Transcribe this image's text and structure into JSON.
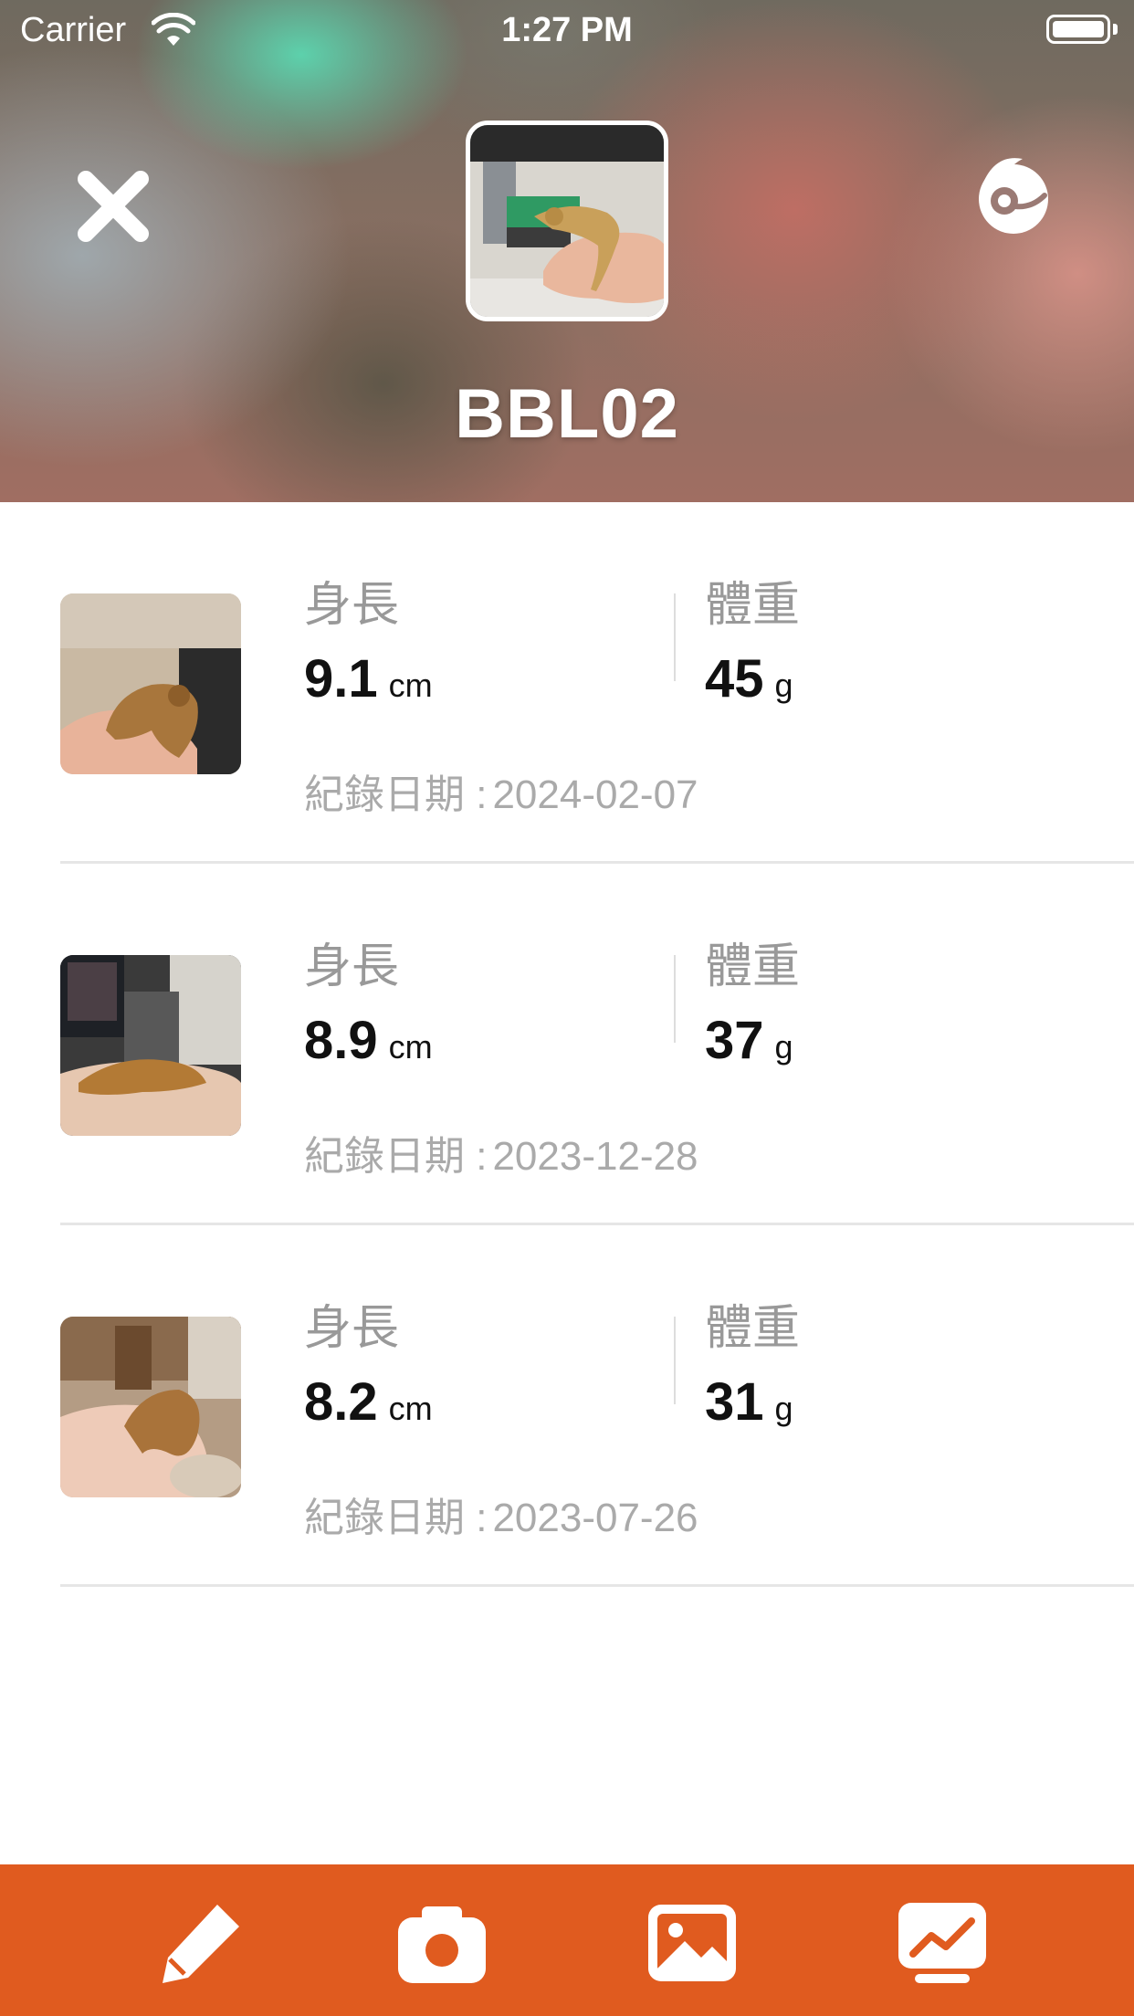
{
  "status_bar": {
    "carrier": "Carrier",
    "time": "1:27 PM"
  },
  "header": {
    "title": "BBL02",
    "close_icon": "close-icon",
    "switch_icon": "chameleon-icon"
  },
  "labels": {
    "length": "身長",
    "weight": "體重",
    "date_prefix": "紀錄日期 :"
  },
  "records": [
    {
      "length": "9.1",
      "length_unit": "cm",
      "weight": "45",
      "weight_unit": "g",
      "date": "2024-02-07"
    },
    {
      "length": "8.9",
      "length_unit": "cm",
      "weight": "37",
      "weight_unit": "g",
      "date": "2023-12-28"
    },
    {
      "length": "8.2",
      "length_unit": "cm",
      "weight": "31",
      "weight_unit": "g",
      "date": "2023-07-26"
    }
  ],
  "toolbar": {
    "icons": [
      "pencil-icon",
      "camera-icon",
      "gallery-icon",
      "chart-icon"
    ]
  },
  "colors": {
    "toolbar_bg": "#e05b1f",
    "label_gray": "#999999",
    "value_black": "#111111"
  }
}
